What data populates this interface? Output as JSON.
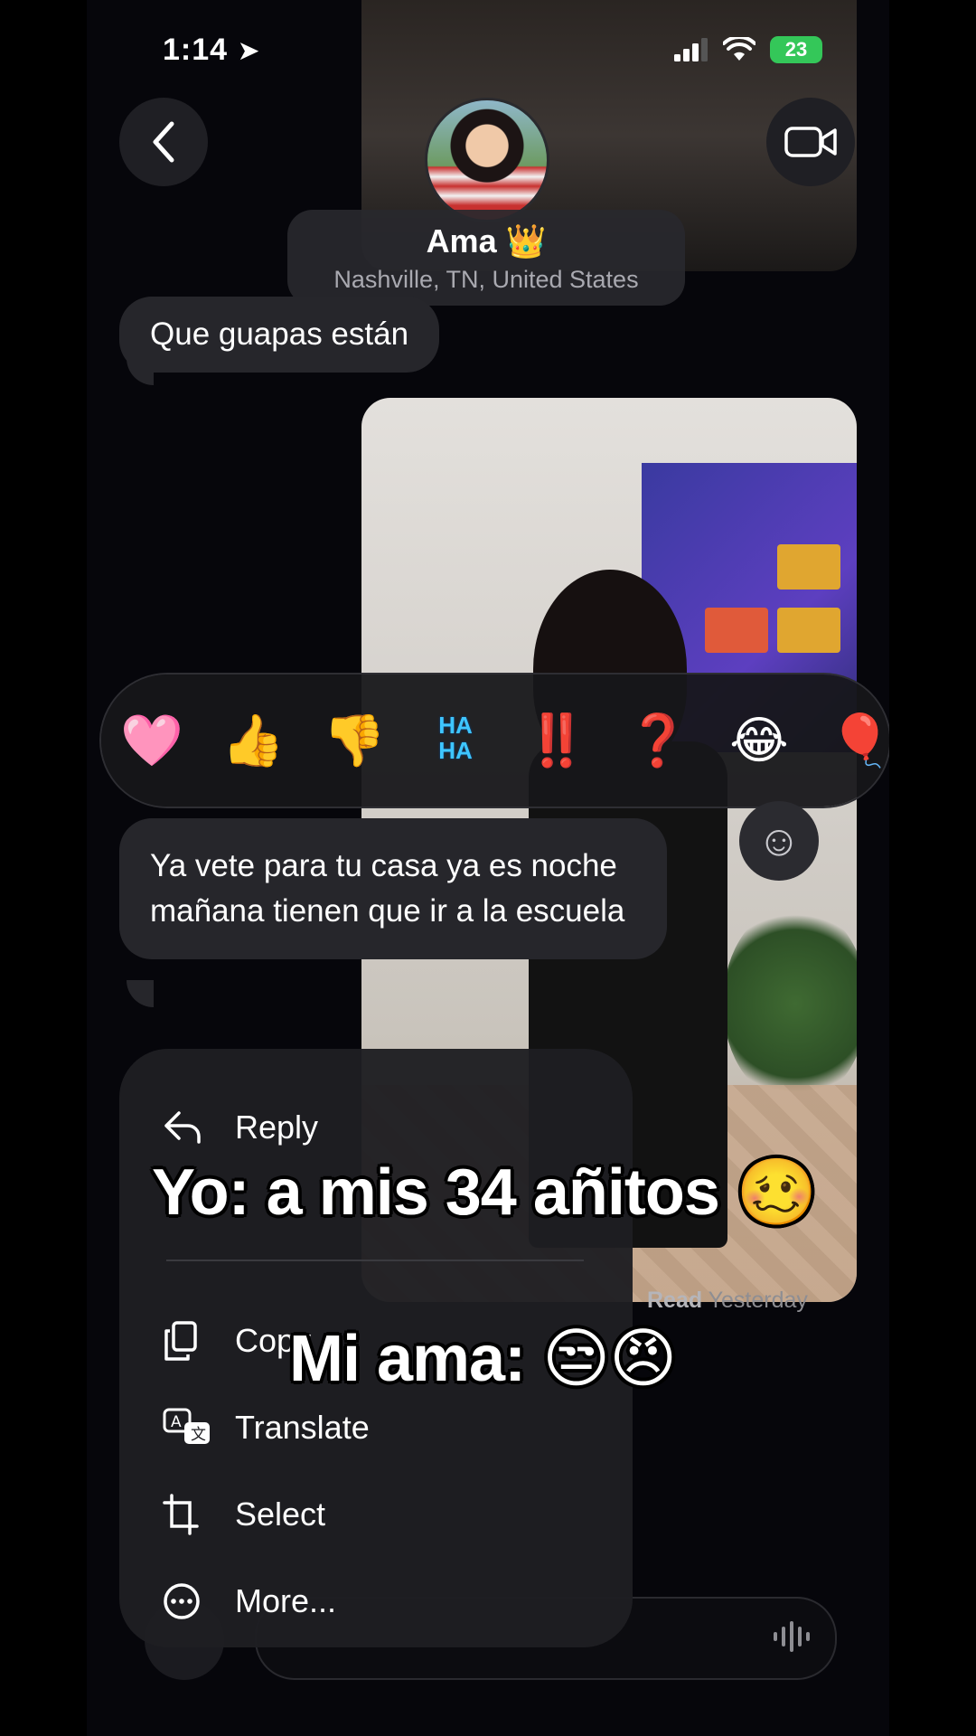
{
  "status_bar": {
    "time": "1:14",
    "battery": "23"
  },
  "header": {
    "contact_name": "Ama 👑",
    "contact_location": "Nashville, TN, United States"
  },
  "messages": [
    {
      "text": "Que guapas están"
    },
    {
      "text": "Ya vete para tu casa ya es noche mañana tienen que ir a la escuela"
    }
  ],
  "reactions": [
    "🩷",
    "👍",
    "👎",
    "🆗",
    "‼️",
    "❓",
    "😂",
    "🎈"
  ],
  "read_receipt": {
    "label": "Read",
    "time": "Yesterday"
  },
  "context_menu": {
    "items": [
      {
        "label": "Reply",
        "icon": "reply-icon"
      },
      {
        "label": "Copy",
        "icon": "copy-icon"
      },
      {
        "label": "Translate",
        "icon": "translate-icon"
      },
      {
        "label": "Select",
        "icon": "select-icon"
      },
      {
        "label": "More...",
        "icon": "more-icon"
      }
    ]
  },
  "captions": {
    "line1": "Yo: a mis 34 añitos 🥴",
    "line2": "Mi ama: 😒😠"
  }
}
